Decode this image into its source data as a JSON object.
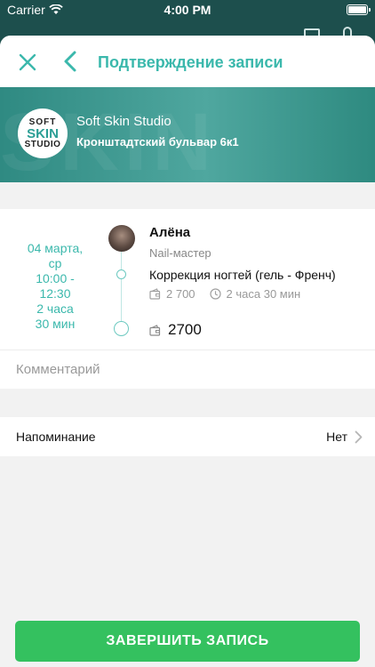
{
  "status_bar": {
    "carrier": "Carrier",
    "time": "4:00 PM"
  },
  "header": {
    "title": "Подтверждение записи"
  },
  "studio": {
    "watermark": "SKIN",
    "logo": {
      "line1": "SOFT",
      "line2": "SKIN",
      "line3": "STUDIO"
    },
    "name": "Soft Skin Studio",
    "address": "Кронштадтский бульвар 6к1"
  },
  "appointment": {
    "date_line1": "04 марта,",
    "date_line2": "ср",
    "time_line1": "10:00 -",
    "time_line2": "12:30",
    "duration_line1": "2 часа",
    "duration_line2": "30 мин",
    "master_name": "Алёна",
    "master_role": "Nail-мастер",
    "service_name": "Коррекция ногтей (гель - Френч)",
    "service_price": "2 700",
    "service_duration": "2 часа 30 мин",
    "total": "2700"
  },
  "comment": {
    "placeholder": "Комментарий",
    "value": ""
  },
  "reminder": {
    "label": "Напоминание",
    "value": "Нет"
  },
  "footer": {
    "finish_label": "ЗАВЕРШИТЬ ЗАПИСЬ"
  },
  "colors": {
    "accent": "#3bb8ac",
    "button": "#34c15f",
    "banner": "#3d968e"
  }
}
